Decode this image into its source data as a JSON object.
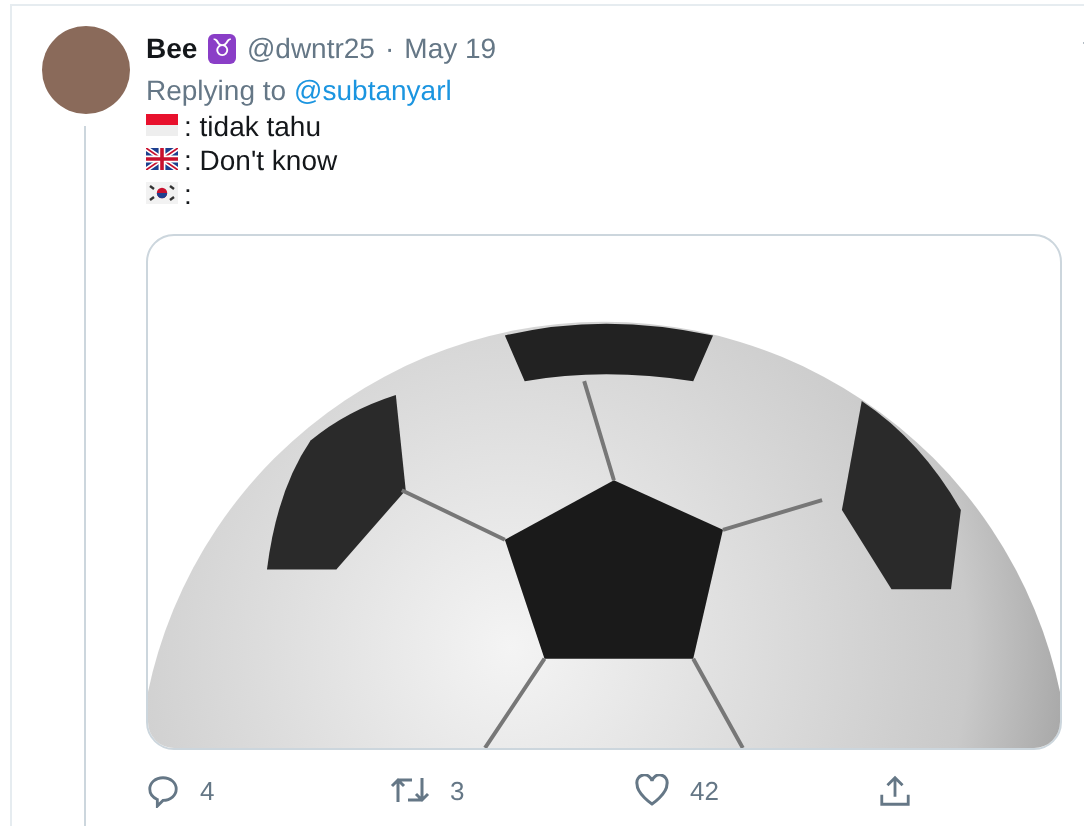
{
  "tweet": {
    "name": "Bee",
    "badge": "♉",
    "handle": "@dwntr25",
    "separator": "·",
    "date": "May 19",
    "replying_label": "Replying to",
    "replying_to": "@subtanyarl",
    "lines": [
      {
        "kind": "indonesia",
        "text": ": tidak tahu"
      },
      {
        "kind": "uk",
        "text": ": Don't know"
      },
      {
        "kind": "korea",
        "text": ":"
      }
    ],
    "actions": [
      {
        "kind": "reply",
        "count": "4"
      },
      {
        "kind": "retweet",
        "count": "3"
      },
      {
        "kind": "like",
        "count": "42"
      },
      {
        "kind": "share"
      }
    ]
  }
}
